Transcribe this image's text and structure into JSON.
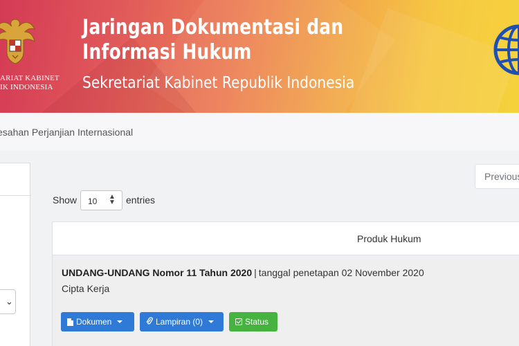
{
  "header": {
    "logo_line1": "ARIAT KABINET",
    "logo_line2": "IK INDONESIA",
    "title_line1": "Jaringan Dokumentasi dan",
    "title_line2": "Informasi Hukum",
    "subtitle": "Sekretariat Kabinet Republik Indonesia"
  },
  "breadcrumb": {
    "text": "esahan Perjanjian Internasional"
  },
  "pagination": {
    "previous_label": "Previous"
  },
  "table_controls": {
    "show_label": "Show",
    "entries_value": "10",
    "entries_label": "entries"
  },
  "table": {
    "column_header": "Produk Hukum",
    "rows": [
      {
        "title": "UNDANG-UNDANG Nomor 11 Tahun 2020",
        "separator": "|",
        "date_text": "tanggal penetapan 02 November 2020",
        "description": "Cipta Kerja",
        "buttons": {
          "dokumen": "Dokumen",
          "lampiran": "Lampiran (0)",
          "status": "Status"
        }
      }
    ]
  },
  "colors": {
    "banner_start": "#d43a55",
    "banner_end": "#f5d23c",
    "button_blue": "#2f7ad6",
    "button_green": "#46b341"
  },
  "icons": [
    "garuda-emblem-icon",
    "globe-icon",
    "document-icon",
    "paperclip-icon",
    "check-square-icon",
    "caret-down-icon",
    "sort-arrows-icon",
    "chevron-down-icon"
  ]
}
